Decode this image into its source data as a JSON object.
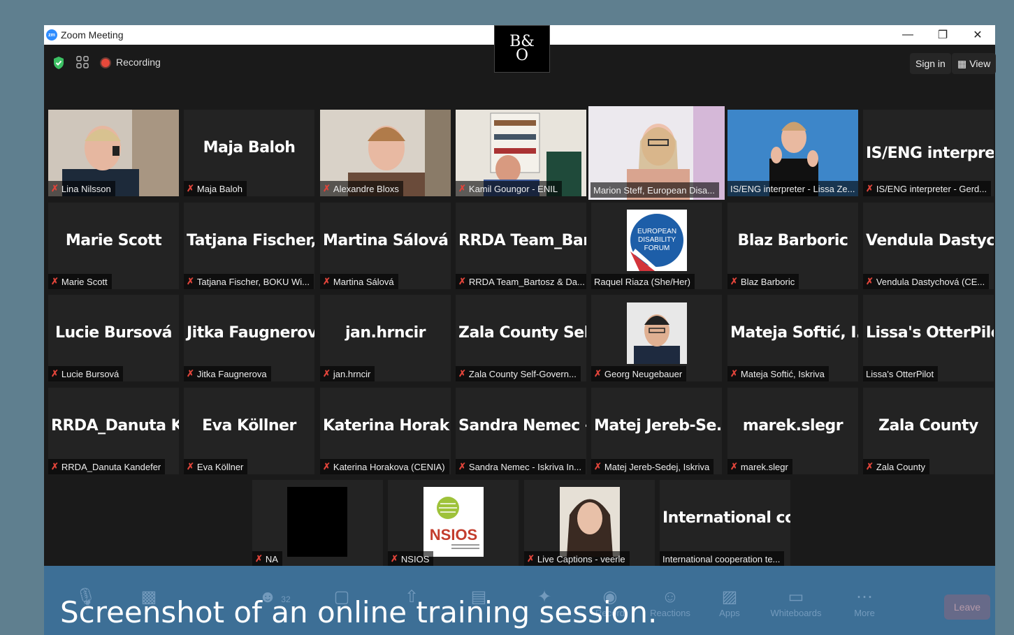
{
  "window": {
    "title": "Zoom Meeting",
    "logo_text": "zm"
  },
  "top_bar": {
    "recording_label": "Recording",
    "sign_in_label": "Sign in",
    "view_label": "View",
    "logo_text_top": "B&",
    "logo_text_bottom": "O"
  },
  "tiles": [
    {
      "label": "Lina Nilsson"
    },
    {
      "display": "Maja Baloh",
      "label": "Maja Baloh"
    },
    {
      "label": "Alexandre Bloxs"
    },
    {
      "label": "Kamil Goungor - ENIL"
    },
    {
      "label": "Marion Steff, European Disa..."
    },
    {
      "label": "IS/ENG interpreter - Lissa Ze..."
    },
    {
      "display": "IS/ENG  interpre...",
      "label": "IS/ENG interpreter - Gerd..."
    },
    {
      "display": "Marie Scott",
      "label": "Marie Scott"
    },
    {
      "display": "Tatjana  Fischer,...",
      "label": "Tatjana Fischer, BOKU Wi..."
    },
    {
      "display": "Martina Sálová",
      "label": "Martina Sálová"
    },
    {
      "display": "RRDA  Team_Bar...",
      "label": "RRDA Team_Bartosz & Da..."
    },
    {
      "label": "Raquel Riaza (She/Her)",
      "logo_lines": [
        "EUROPEAN",
        "DISABILITY",
        "FORUM"
      ]
    },
    {
      "display": "Blaz Barboric",
      "label": "Blaz Barboric"
    },
    {
      "display": "Vendula  Dastyc...",
      "label": "Vendula Dastychová (CE..."
    },
    {
      "display": "Lucie Bursová",
      "label": "Lucie Bursová"
    },
    {
      "display": "Jitka Faugnerova",
      "label": "Jitka Faugnerova"
    },
    {
      "display": "jan.hrncir",
      "label": "jan.hrncir"
    },
    {
      "display": "Zala  County  Sel...",
      "label": "Zala County Self-Govern..."
    },
    {
      "label": "Georg Neugebauer"
    },
    {
      "display": "Mateja  Softić,  I...",
      "label": "Mateja Softić, Iskriva"
    },
    {
      "display": "Lissa's OtterPilot",
      "label": "Lissa's OtterPilot"
    },
    {
      "display": "RRDA_Danuta  K...",
      "label": "RRDA_Danuta Kandefer"
    },
    {
      "display": "Eva Köllner",
      "label": "Eva Köllner"
    },
    {
      "display": "Katerina  Horak...",
      "label": "Katerina Horakova (CENIA)"
    },
    {
      "display": "Sandra  Nemec  -...",
      "label": "Sandra Nemec - Iskriva In..."
    },
    {
      "display": "Matej  Jereb-Se...",
      "label": "Matej Jereb-Sedej, Iskriva"
    },
    {
      "display": "marek.slegr",
      "label": "marek.slegr"
    },
    {
      "display": "Zala County",
      "label": "Zala County"
    },
    {
      "label": "NA"
    },
    {
      "label": "NSIOS",
      "logo_text": "NSIOS"
    },
    {
      "label": "Live Captions - veerle"
    },
    {
      "display": "International  co...",
      "label": "International cooperation te..."
    }
  ],
  "toolbar": {
    "participants_count": "32",
    "items": [
      "Record",
      "Reactions",
      "Apps",
      "Whiteboards",
      "More"
    ],
    "leave_label": "Leave"
  },
  "caption": "Screenshot of an online training session.",
  "colors": {
    "active_speaker": "#d8e36a",
    "toolbar_bg": "#3d6f96",
    "mute": "#e0443a"
  }
}
